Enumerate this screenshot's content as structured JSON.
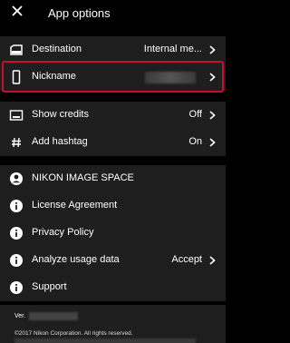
{
  "app_bar": {
    "close_icon": "close-icon",
    "title": "App options"
  },
  "rows": {
    "destination": {
      "label": "Destination",
      "value": "Internal me...",
      "icon": "sd-card-icon"
    },
    "nickname": {
      "label": "Nickname",
      "value": "",
      "icon": "phone-icon"
    },
    "show_credits": {
      "label": "Show credits",
      "value": "Off",
      "icon": "caption-icon"
    },
    "add_hashtag": {
      "label": "Add hashtag",
      "value": "On",
      "icon": "hash-icon"
    },
    "nikon_image_space": {
      "label": "NIKON IMAGE SPACE",
      "icon": "account-icon"
    },
    "license": {
      "label": "License Agreement",
      "icon": "info-icon"
    },
    "privacy": {
      "label": "Privacy Policy",
      "icon": "info-icon"
    },
    "analyze": {
      "label": "Analyze usage data",
      "value": "Accept",
      "icon": "info-icon"
    },
    "support": {
      "label": "Support",
      "icon": "info-icon"
    }
  },
  "footer": {
    "version_label": "Ver.",
    "copyright": "©2017 Nikon Corporation. All rights reserved."
  },
  "colors": {
    "background": "#000000",
    "row": "#1e1e1e",
    "highlight": "#c8102e"
  }
}
